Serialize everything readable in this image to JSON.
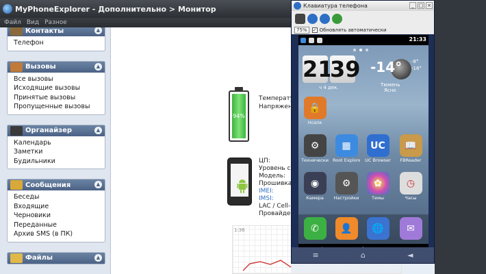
{
  "main_window": {
    "title": "MyPhoneExplorer -  Дополнительно > Монитор",
    "menu": [
      "Файл",
      "Вид",
      "Разное"
    ]
  },
  "sidebar": {
    "groups": [
      {
        "title": "Контакты",
        "icon": "contacts-icon",
        "color": "#8a6a3a",
        "items": [
          "Телефон"
        ]
      },
      {
        "title": "Вызовы",
        "icon": "calls-icon",
        "color": "#c07a3a",
        "items": [
          "Все вызовы",
          "Исходящие вызовы",
          "Принятые вызовы",
          "Пропущенные вызовы"
        ]
      },
      {
        "title": "Органайзер",
        "icon": "organizer-icon",
        "color": "#3a3a3a",
        "items": [
          "Календарь",
          "Заметки",
          "Будильники"
        ]
      },
      {
        "title": "Сообщения",
        "icon": "messages-icon",
        "color": "#d8a93a",
        "items": [
          "Беседы",
          "Входящие",
          "Черновики",
          "Переданные",
          "Архив SMS (в ПК)"
        ]
      },
      {
        "title": "Файлы",
        "icon": "files-icon",
        "color": "#e0b84a",
        "items": []
      }
    ]
  },
  "monitor": {
    "battery_percent": "94%",
    "battery_level": 0.94,
    "battery_labels": [
      "Температур",
      "Напряжени"
    ],
    "phone_labels": [
      "ЦП:",
      "Уровень си",
      "Модель:",
      "Прошивка:"
    ],
    "phone_links": [
      "IMEI:",
      "IMSI:"
    ],
    "phone_labels_2": [
      "LAC / Cell-ID",
      "Провайдер"
    ],
    "graph_label": "1:36"
  },
  "phone_window": {
    "title": "Клавиатура телефона",
    "zoom": "75%",
    "option": "Обновлять автоматически",
    "status_time": "21:33",
    "clock_hours": "21",
    "clock_minutes": "39",
    "temperature": "-14°",
    "weather_date": "ч 4 дек.",
    "weather_city": "Тюмень",
    "weather_desc": "Ясно",
    "weather_hi": "-8°",
    "weather_lo": "-16°",
    "apps": [
      {
        "label": "Нсапк",
        "icon": "lock-app-icon",
        "color": "#e07a2a"
      },
      {
        "label": "Технически",
        "icon": "settings-app-icon",
        "color": "#444"
      },
      {
        "label": "Root Explorer",
        "icon": "explorer-app-icon",
        "color": "#3d8be0"
      },
      {
        "label": "UC Browser",
        "icon": "browser-app-icon",
        "color": "#2f6fcf"
      },
      {
        "label": "FBReader",
        "icon": "reader-app-icon",
        "color": "#c89a4a"
      },
      {
        "label": "Камера",
        "icon": "camera-app-icon",
        "color": "#3b3f55"
      },
      {
        "label": "Настройки",
        "icon": "gear-app-icon",
        "color": "#555"
      },
      {
        "label": "Темы",
        "icon": "themes-app-icon",
        "color": "#d04fb0"
      },
      {
        "label": "Часы",
        "icon": "clock-app-icon",
        "color": "#ddd"
      }
    ],
    "dock": [
      {
        "icon": "phone-app-icon",
        "color": "#3cb043"
      },
      {
        "icon": "contacts-app-icon",
        "color": "#f08a2a"
      },
      {
        "icon": "globe-app-icon",
        "color": "#3a73d0"
      },
      {
        "icon": "messaging-app-icon",
        "color": "#a07ad8"
      }
    ]
  }
}
